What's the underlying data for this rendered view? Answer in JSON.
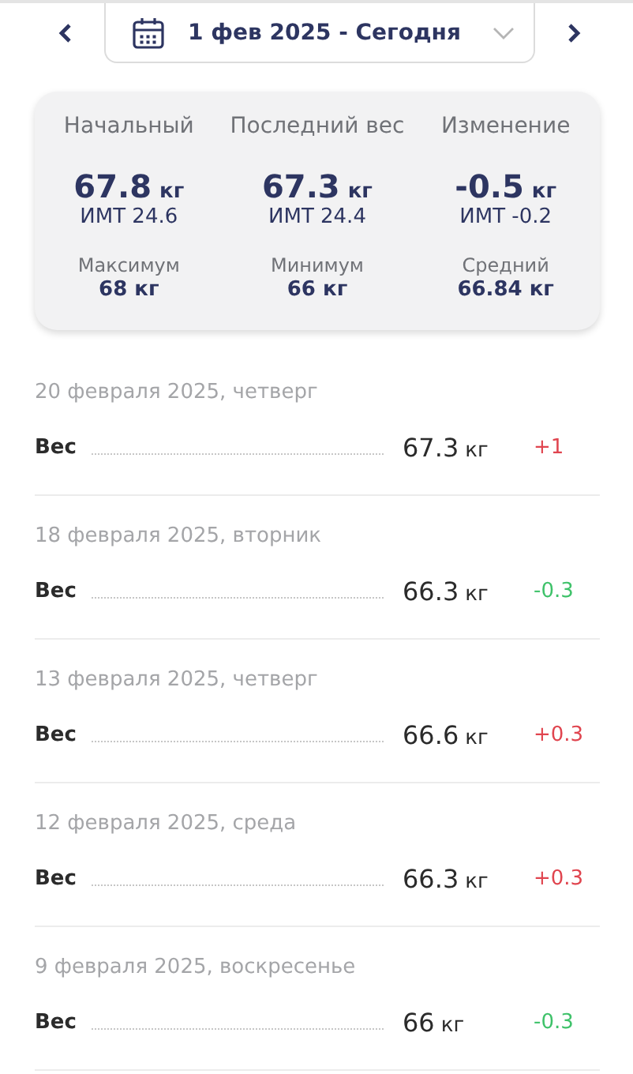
{
  "date_range": {
    "label": "1 фев 2025 - Сегодня"
  },
  "summary": {
    "top": [
      {
        "title": "Начальный",
        "value": "67.8",
        "unit": "кг",
        "bmi": "ИМТ 24.6"
      },
      {
        "title": "Последний вес",
        "value": "67.3",
        "unit": "кг",
        "bmi": "ИМТ 24.4"
      },
      {
        "title": "Изменение",
        "value": "-0.5",
        "unit": "кг",
        "bmi": "ИМТ -0.2"
      }
    ],
    "bottom": [
      {
        "title": "Максимум",
        "value": "68 кг"
      },
      {
        "title": "Минимум",
        "value": "66 кг"
      },
      {
        "title": "Средний",
        "value": "66.84 кг"
      }
    ]
  },
  "entries": [
    {
      "date": "20 февраля 2025, четверг",
      "label": "Вес",
      "value": "67.3",
      "unit": "кг",
      "delta": "+1",
      "color": "#e0454f"
    },
    {
      "date": "18 февраля 2025, вторник",
      "label": "Вес",
      "value": "66.3",
      "unit": "кг",
      "delta": "-0.3",
      "color": "#3fc26a"
    },
    {
      "date": "13 февраля 2025, четверг",
      "label": "Вес",
      "value": "66.6",
      "unit": "кг",
      "delta": "+0.3",
      "color": "#e0454f"
    },
    {
      "date": "12 февраля 2025, среда",
      "label": "Вес",
      "value": "66.3",
      "unit": "кг",
      "delta": "+0.3",
      "color": "#e0454f"
    },
    {
      "date": "9 февраля 2025, воскресенье",
      "label": "Вес",
      "value": "66",
      "unit": "кг",
      "delta": "-0.3",
      "color": "#3fc26a"
    }
  ]
}
